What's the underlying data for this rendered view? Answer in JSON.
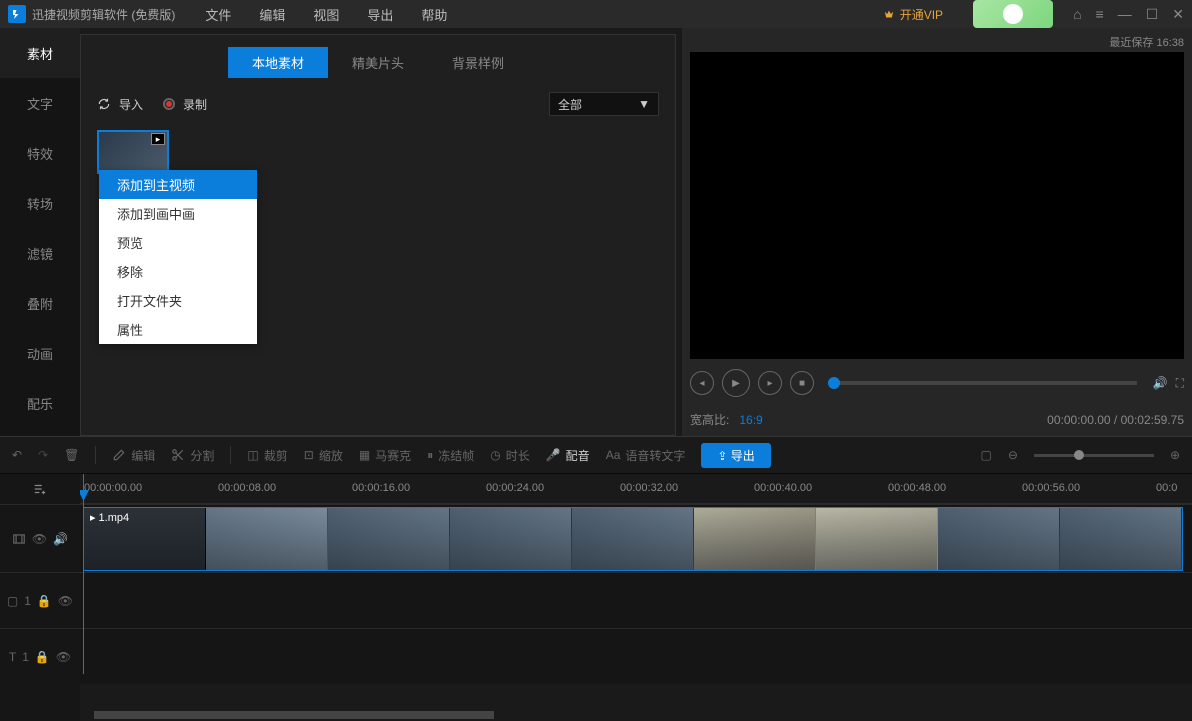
{
  "title": "迅捷视频剪辑软件 (免费版)",
  "menu": [
    "文件",
    "编辑",
    "视图",
    "导出",
    "帮助"
  ],
  "vip_label": "开通VIP",
  "save_time": "最近保存 16:38",
  "sidebar": {
    "items": [
      {
        "label": "素材"
      },
      {
        "label": "文字"
      },
      {
        "label": "特效"
      },
      {
        "label": "转场"
      },
      {
        "label": "滤镜"
      },
      {
        "label": "叠附"
      },
      {
        "label": "动画"
      },
      {
        "label": "配乐"
      }
    ]
  },
  "tabs": {
    "local": "本地素材",
    "intro": "精美片头",
    "bg": "背景样例"
  },
  "toolbar": {
    "import_label": "导入",
    "record_label": "录制",
    "filter_all": "全部"
  },
  "context_menu": {
    "items": [
      {
        "label": "添加到主视频"
      },
      {
        "label": "添加到画中画"
      },
      {
        "label": "预览"
      },
      {
        "label": "移除"
      },
      {
        "label": "打开文件夹"
      },
      {
        "label": "属性"
      }
    ]
  },
  "preview": {
    "ratio_label": "宽高比:",
    "ratio_value": "16:9",
    "time_current": "00:00:00.00",
    "time_total": "00:02:59.75"
  },
  "strip": {
    "edit": "编辑",
    "split": "分割",
    "crop": "裁剪",
    "zoom": "缩放",
    "mosaic": "马赛克",
    "freeze": "冻结帧",
    "duration": "时长",
    "dub": "配音",
    "stt": "语音转文字",
    "export": "导出"
  },
  "timeline": {
    "ticks": [
      "00:00:00.00",
      "00:00:08.00",
      "00:00:16.00",
      "00:00:24.00",
      "00:00:32.00",
      "00:00:40.00",
      "00:00:48.00",
      "00:00:56.00"
    ],
    "last_tick": "00:0",
    "clip_name": "1.mp4",
    "text_track_num": "1",
    "overlay_track_num": "1"
  }
}
